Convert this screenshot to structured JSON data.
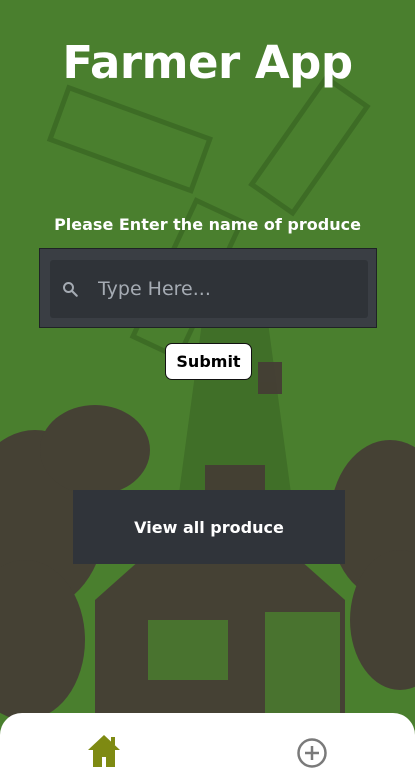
{
  "app": {
    "title": "Farmer App"
  },
  "search": {
    "prompt": "Please Enter the name of produce",
    "placeholder": "Type Here...",
    "value": "",
    "submit_label": "Submit"
  },
  "actions": {
    "view_all_label": "View all produce"
  },
  "tabbar": {
    "tabs": [
      {
        "name": "home",
        "icon": "home-icon",
        "active": true
      },
      {
        "name": "add",
        "icon": "add-circle-icon",
        "active": false
      }
    ]
  },
  "colors": {
    "background": "#4a7f2e",
    "panel": "#30343a",
    "accent_active": "#7e8a12",
    "inactive_icon": "#7a7a7a"
  }
}
